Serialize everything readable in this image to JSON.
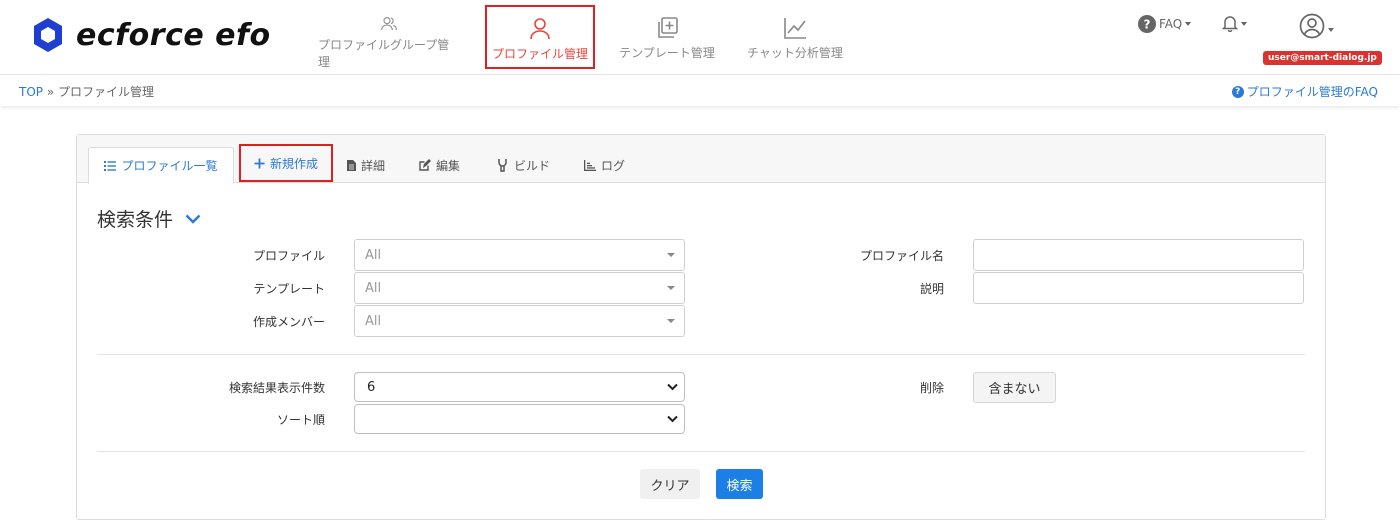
{
  "app": {
    "logo_text": "ecforce efo",
    "brand_color": "#1e3fd0",
    "accent_color": "#1c7fe6",
    "highlight_color": "#e02020"
  },
  "nav": [
    {
      "label": "プロファイルグループ管理",
      "icon": "users-icon",
      "active": false
    },
    {
      "label": "プロファイル管理",
      "icon": "user-icon",
      "active": true
    },
    {
      "label": "テンプレート管理",
      "icon": "template-add-icon",
      "active": false
    },
    {
      "label": "チャット分析管理",
      "icon": "line-chart-icon",
      "active": false
    }
  ],
  "header_right": {
    "faq_label": "FAQ",
    "user_email": "user@smart-dialog.jp"
  },
  "breadcrumb": {
    "top": "TOP",
    "separator": "»",
    "current": "プロファイル管理",
    "faq_link": "プロファイル管理のFAQ"
  },
  "tabs": [
    {
      "label": "プロファイル一覧",
      "icon": "list-icon"
    },
    {
      "label": "新規作成",
      "icon": "plus-icon"
    },
    {
      "label": "詳細",
      "icon": "document-icon"
    },
    {
      "label": "編集",
      "icon": "edit-icon"
    },
    {
      "label": "ビルド",
      "icon": "wrench-icon"
    },
    {
      "label": "ログ",
      "icon": "bar-chart-icon"
    }
  ],
  "search": {
    "title": "検索条件",
    "profile_label": "プロファイル",
    "profile_value": "All",
    "template_label": "テンプレート",
    "template_value": "All",
    "member_label": "作成メンバー",
    "member_value": "All",
    "profile_name_label": "プロファイル名",
    "description_label": "説明",
    "count_label": "検索結果表示件数",
    "count_value": "6",
    "sort_label": "ソート順",
    "sort_value": "",
    "delete_label": "削除",
    "delete_toggle": "含まない",
    "clear_button": "クリア",
    "search_button": "検索"
  }
}
